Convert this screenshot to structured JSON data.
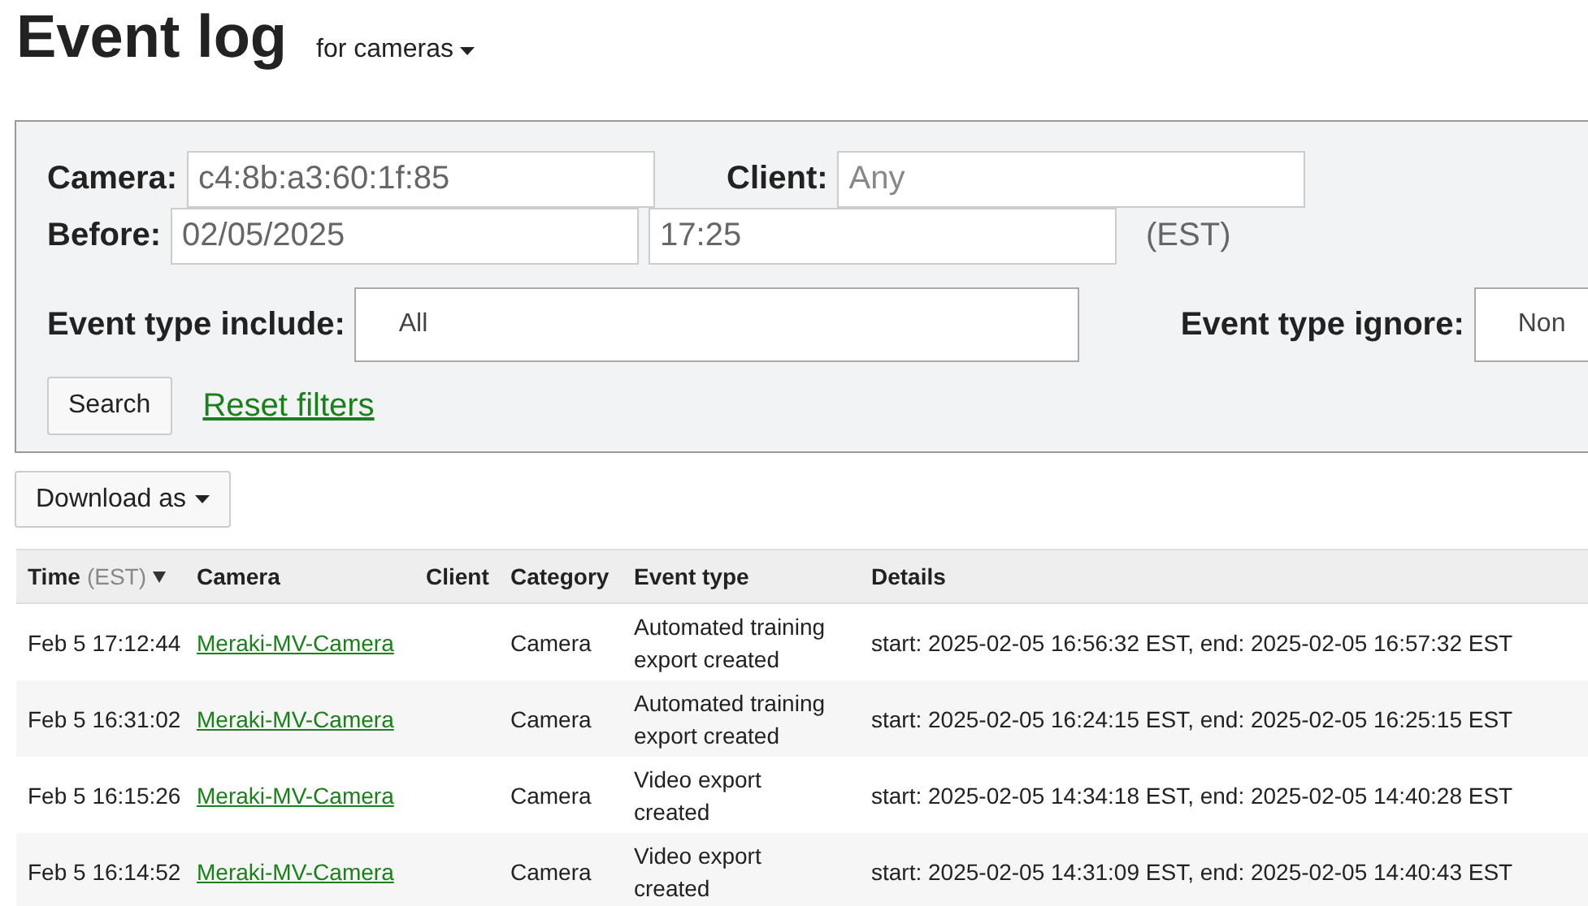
{
  "header": {
    "title": "Event log",
    "scope": "for cameras"
  },
  "filters": {
    "camera": {
      "label": "Camera:",
      "value": "c4:8b:a3:60:1f:85"
    },
    "client": {
      "label": "Client:",
      "placeholder": "Any"
    },
    "before": {
      "label": "Before:",
      "date": "02/05/2025",
      "time": "17:25",
      "timezone": "(EST)"
    },
    "event_type_include": {
      "label": "Event type include:",
      "value": "All"
    },
    "event_type_ignore": {
      "label": "Event type ignore:",
      "value": "Non"
    },
    "search_button": "Search",
    "reset_link": "Reset filters"
  },
  "download_button": "Download as",
  "table": {
    "columns": [
      {
        "label": "Time",
        "note": "(EST)",
        "sorted": true
      },
      {
        "label": "Camera",
        "sorted": false
      },
      {
        "label": "Client",
        "sorted": false
      },
      {
        "label": "Category",
        "sorted": false
      },
      {
        "label": "Event type",
        "sorted": false
      },
      {
        "label": "Details",
        "sorted": false
      }
    ],
    "rows": [
      {
        "time": "Feb 5 17:12:44",
        "camera": "Meraki-MV-Camera",
        "client": "",
        "category": "Camera",
        "event_type": "Automated training export created",
        "details": "start: 2025-02-05 16:56:32 EST, end: 2025-02-05 16:57:32 EST"
      },
      {
        "time": "Feb 5 16:31:02",
        "camera": "Meraki-MV-Camera",
        "client": "",
        "category": "Camera",
        "event_type": "Automated training export created",
        "details": "start: 2025-02-05 16:24:15 EST, end: 2025-02-05 16:25:15 EST"
      },
      {
        "time": "Feb 5 16:15:26",
        "camera": "Meraki-MV-Camera",
        "client": "",
        "category": "Camera",
        "event_type": "Video export created",
        "details": "start: 2025-02-05 14:34:18 EST, end: 2025-02-05 14:40:28 EST"
      },
      {
        "time": "Feb 5 16:14:52",
        "camera": "Meraki-MV-Camera",
        "client": "",
        "category": "Camera",
        "event_type": "Video export created",
        "details": "start: 2025-02-05 14:31:09 EST, end: 2025-02-05 14:40:43 EST"
      }
    ]
  }
}
